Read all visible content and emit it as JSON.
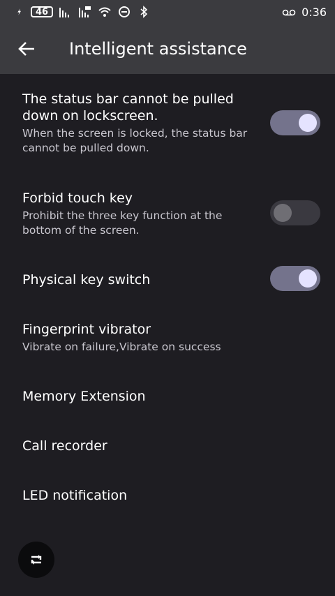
{
  "status_bar": {
    "battery": "46",
    "time": "0:36"
  },
  "app_bar": {
    "title": "Intelligent assistance"
  },
  "settings": [
    {
      "title": "The status bar cannot be pulled down on lockscreen.",
      "subtitle": "When the screen is locked, the status bar cannot be pulled down.",
      "toggle": "on"
    },
    {
      "title": "Forbid touch key",
      "subtitle": "Prohibit the three key function at the bottom of the screen.",
      "toggle": "off"
    },
    {
      "title": "Physical key switch",
      "toggle": "on"
    },
    {
      "title": "Fingerprint vibrator",
      "subtitle": "Vibrate on failure,Vibrate on success"
    },
    {
      "title": "Memory Extension"
    },
    {
      "title": "Call recorder"
    },
    {
      "title": "LED notification"
    }
  ],
  "colors": {
    "background": "#1e1d22",
    "bar": "#3b3b3f",
    "toggle_on_track": "#74738c",
    "toggle_on_knob": "#e5e3ff"
  }
}
